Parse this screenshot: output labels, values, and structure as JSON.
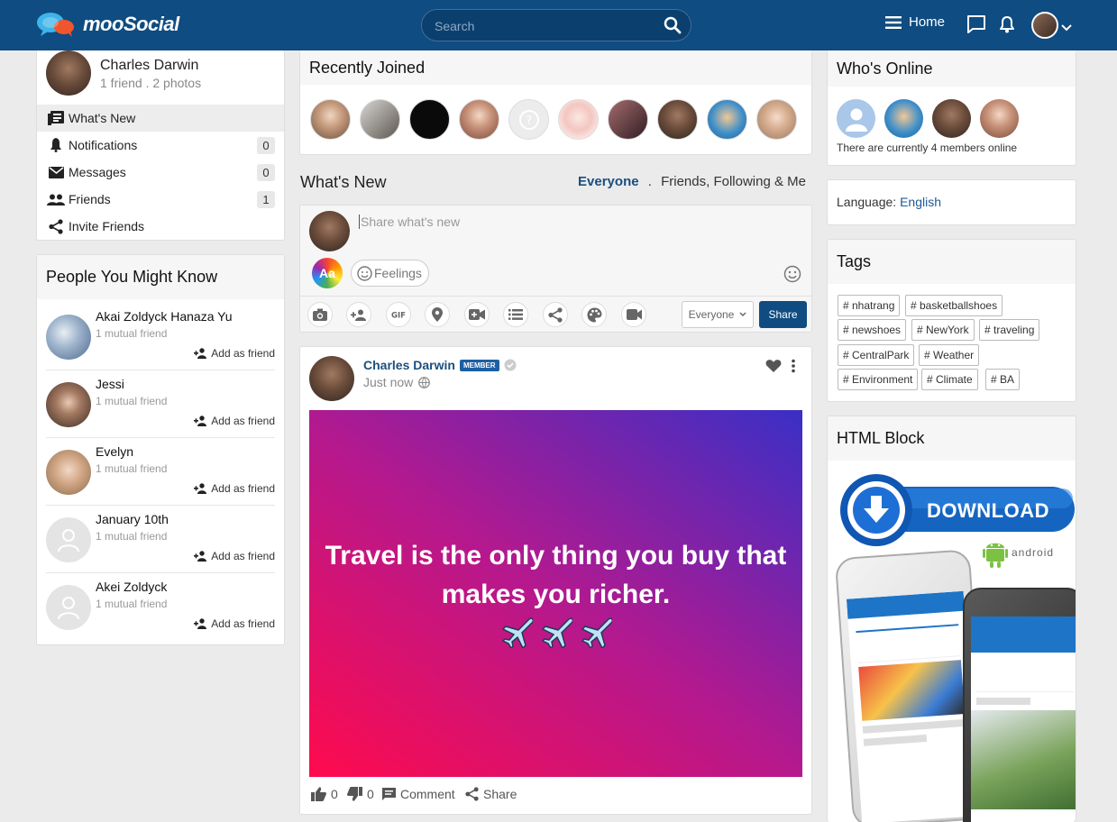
{
  "brand": {
    "name": "mooSocial"
  },
  "header": {
    "search_placeholder": "Search",
    "home_label": "Home"
  },
  "colors": {
    "primary": "#0f4c81",
    "background": "#ebebeb",
    "link": "#1a4f7f"
  },
  "profile": {
    "name": "Charles Darwin",
    "sub": "1 friend . 2 photos"
  },
  "left_menu": [
    {
      "label": "What's New",
      "icon": "newsfeed-icon"
    },
    {
      "label": "Notifications",
      "count": "0",
      "icon": "bell-icon"
    },
    {
      "label": "Messages",
      "count": "0",
      "icon": "envelope-icon"
    },
    {
      "label": "Friends",
      "count": "1",
      "icon": "people-icon"
    },
    {
      "label": "Invite Friends",
      "icon": "share-icon"
    }
  ],
  "pymk": {
    "title": "People You Might Know",
    "people": [
      {
        "name": "Akai Zoldyck Hanaza Yu",
        "mutual": "1 mutual friend",
        "action": "Add as friend"
      },
      {
        "name": "Jessi",
        "mutual": "1 mutual friend",
        "action": "Add as friend"
      },
      {
        "name": "Evelyn",
        "mutual": "1 mutual friend",
        "action": "Add as friend"
      },
      {
        "name": "January 10th",
        "mutual": "1 mutual friend",
        "action": "Add as friend"
      },
      {
        "name": "Akei Zoldyck",
        "mutual": "1 mutual friend",
        "action": "Add as friend"
      }
    ]
  },
  "recently_joined": {
    "title": "Recently Joined"
  },
  "whats_new": {
    "title": "What's New",
    "filter_everyone": "Everyone",
    "filter_sep": ".",
    "filter_friends": "Friends, Following & Me",
    "placeholder": "Share what's new",
    "text_style_label": "Aa",
    "feelings_label": "Feelings",
    "privacy_value": "Everyone",
    "share_label": "Share"
  },
  "post": {
    "author": "Charles Darwin",
    "badge": "MEMBER",
    "time": "Just now",
    "text": "Travel is the only thing you buy that makes you richer.",
    "likes": "0",
    "dislikes": "0",
    "comment_label": "Comment",
    "share_label": "Share"
  },
  "whos_online": {
    "title": "Who's Online",
    "status": "There are currently 4 members online"
  },
  "language": {
    "label": "Language:",
    "value": "English"
  },
  "tags": {
    "title": "Tags",
    "items": [
      "# nhatrang",
      "# basketballshoes",
      "# newshoes",
      "# NewYork",
      "# traveling",
      "# CentralPark",
      "# Weather",
      "# Environment",
      "# Climate",
      "# BA"
    ]
  },
  "html_block": {
    "title": "HTML Block",
    "download_label": "DOWNLOAD",
    "android_label": "android"
  }
}
